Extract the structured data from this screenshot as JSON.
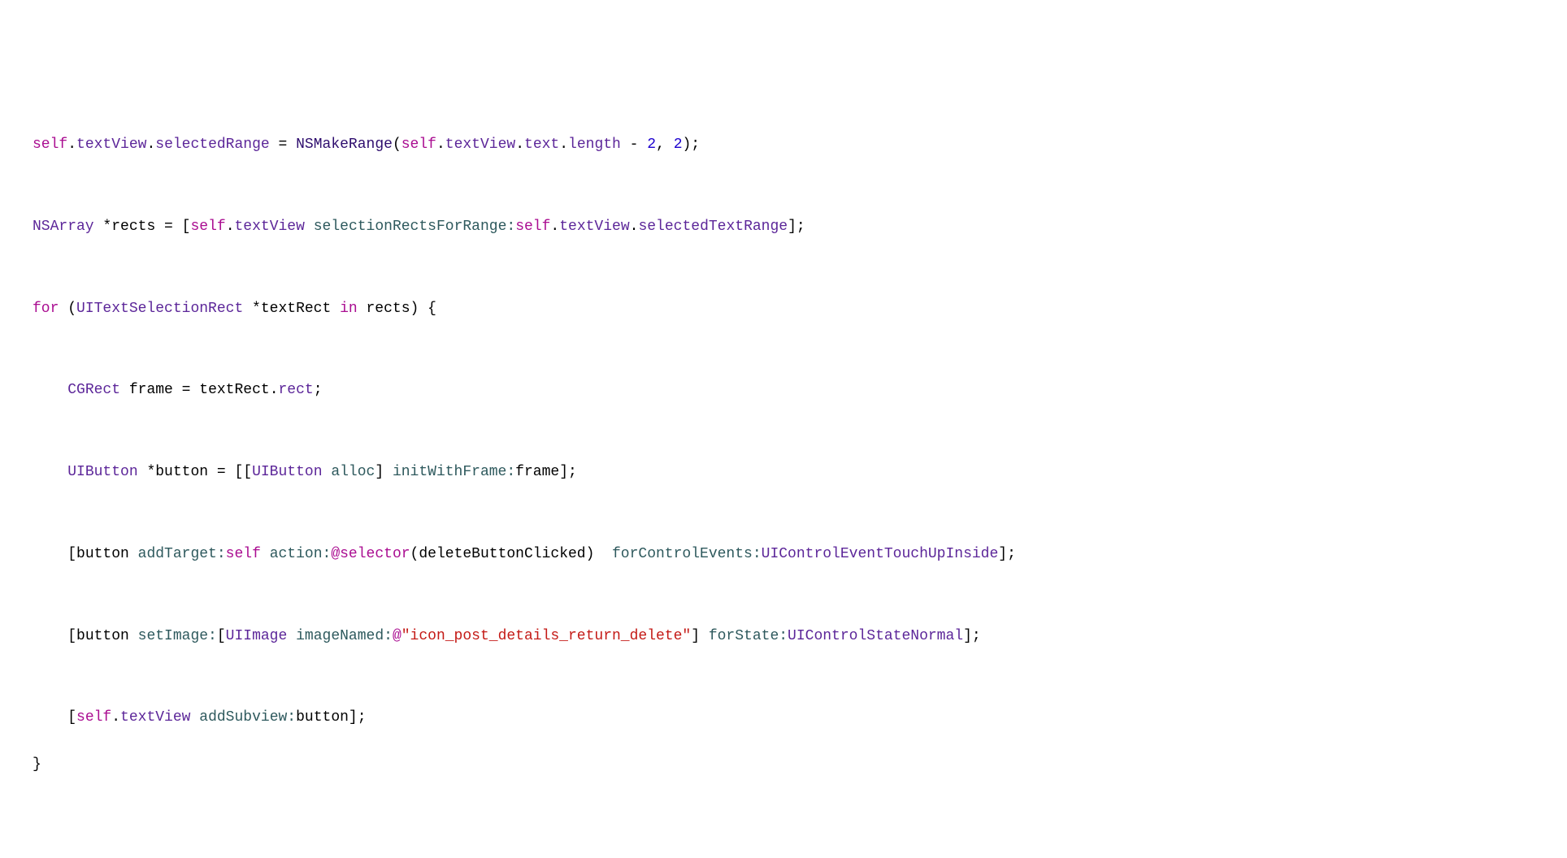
{
  "code": {
    "l1": {
      "self1": "self",
      "dot1": ".",
      "textView1": "textView",
      "dot2": ".",
      "selectedRange": "selectedRange",
      "eq": " = ",
      "nsMakeRange": "NSMakeRange",
      "lparen": "(",
      "self2": "self",
      "dot3": ".",
      "textView2": "textView",
      "dot4": ".",
      "text": "text",
      "dot5": ".",
      "length": "length",
      "minus": " - ",
      "two1": "2",
      "comma": ", ",
      "two2": "2",
      "rparen": ");"
    },
    "l2": {
      "nsArray": "NSArray",
      "star": " *",
      "rects": "rects",
      "eq": " = [",
      "self": "self",
      "dot1": ".",
      "textView": "textView",
      "space": " ",
      "selectionRects": "selectionRectsForRange:",
      "self2": "self",
      "dot2": ".",
      "textView2": "textView",
      "dot3": ".",
      "selectedTextRange": "selectedTextRange",
      "close": "];"
    },
    "l3": {
      "for": "for",
      "lparen": " (",
      "uiTextSelectionRect": "UITextSelectionRect",
      "star": " *",
      "textRect": "textRect",
      "in": " in ",
      "rects": "rects",
      "rparen": ") {"
    },
    "l4": {
      "indent": "    ",
      "cgRect": "CGRect",
      "space": " ",
      "frame": "frame",
      "eq": " = ",
      "textRect": "textRect",
      "dot": ".",
      "rect": "rect",
      "semi": ";"
    },
    "l5": {
      "indent": "    ",
      "uiButton1": "UIButton",
      "star": " *",
      "button": "button",
      "eq": " = [[",
      "uiButton2": "UIButton",
      "space": " ",
      "alloc": "alloc",
      "close1": "] ",
      "initWithFrame": "initWithFrame:",
      "frame": "frame",
      "close2": "];"
    },
    "l6": {
      "indent": "    [",
      "button": "button",
      "space1": " ",
      "addTarget": "addTarget:",
      "self": "self",
      "space2": " ",
      "action": "action:",
      "at": "@selector",
      "lparen": "(",
      "deleteButtonClicked": "deleteButtonClicked",
      "rparen": ")  ",
      "forControlEvents": "forControlEvents:",
      "uiControlEvent": "UIControlEventTouchUpInside",
      "close": "];"
    },
    "l7": {
      "indent": "    [",
      "button": "button",
      "space1": " ",
      "setImage": "setImage:",
      "lbracket": "[",
      "uiImage": "UIImage",
      "space2": " ",
      "imageNamed": "imageNamed:",
      "at": "@",
      "string": "\"icon_post_details_return_delete\"",
      "rbracket": "] ",
      "forState": "forState:",
      "uiControlState": "UIControlStateNormal",
      "close": "];"
    },
    "l8": {
      "indent": "    [",
      "self": "self",
      "dot": ".",
      "textView": "textView",
      "space": " ",
      "addSubview": "addSubview:",
      "button": "button",
      "close": "];"
    },
    "l9": {
      "close": "}"
    }
  }
}
